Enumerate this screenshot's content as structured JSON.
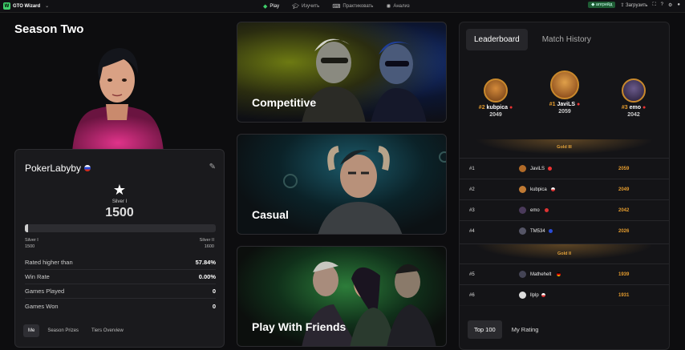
{
  "app": {
    "name": "GTO Wizard"
  },
  "nav": [
    {
      "label": "Play",
      "icon": "diamond-icon",
      "active": true
    },
    {
      "label": "Изучить",
      "icon": "graduation-cap-icon",
      "active": false
    },
    {
      "label": "Практиковать",
      "icon": "gamepad-icon",
      "active": false
    },
    {
      "label": "Анализ",
      "icon": "sun-icon",
      "active": false
    }
  ],
  "toolbar": {
    "upgrade": "апгрейд",
    "upload": "Загрузить"
  },
  "season": {
    "title": "Season Two"
  },
  "profile": {
    "name": "PokerLabyby",
    "rank": "Silver I",
    "rating": "1500",
    "progress": 0.01,
    "tier_low": {
      "name": "Silver I",
      "value": "1500"
    },
    "tier_high": {
      "name": "Silver II",
      "value": "1600"
    },
    "stats": [
      {
        "label": "Rated higher than",
        "value": "57.84%"
      },
      {
        "label": "Win Rate",
        "value": "0.00%"
      },
      {
        "label": "Games Played",
        "value": "0"
      },
      {
        "label": "Games Won",
        "value": "0"
      }
    ],
    "tabs": [
      "Me",
      "Season Prizes",
      "Tiers Overview"
    ]
  },
  "modes": [
    "Competitive",
    "Casual",
    "Play With Friends"
  ],
  "leaderboard": {
    "tabs": [
      "Leaderboard",
      "Match History"
    ],
    "podium": [
      {
        "rank": "#2",
        "name": "kubpica",
        "score": "2049"
      },
      {
        "rank": "#1",
        "name": "JaviLS",
        "score": "2059"
      },
      {
        "rank": "#3",
        "name": "emo",
        "score": "2042"
      }
    ],
    "tier_gold3": "Gold III",
    "tier_gold2": "Gold II",
    "rows": [
      {
        "rank": "#1",
        "name": "JaviLS",
        "score": "2059"
      },
      {
        "rank": "#2",
        "name": "kubpica",
        "score": "2049"
      },
      {
        "rank": "#3",
        "name": "emo",
        "score": "2042"
      },
      {
        "rank": "#4",
        "name": "TM534",
        "score": "2026"
      },
      {
        "rank": "#5",
        "name": "Mathehelt",
        "score": "1939"
      },
      {
        "rank": "#6",
        "name": "llplp",
        "score": "1931"
      }
    ],
    "bottom_tabs": [
      "Top 100",
      "My Rating"
    ]
  }
}
